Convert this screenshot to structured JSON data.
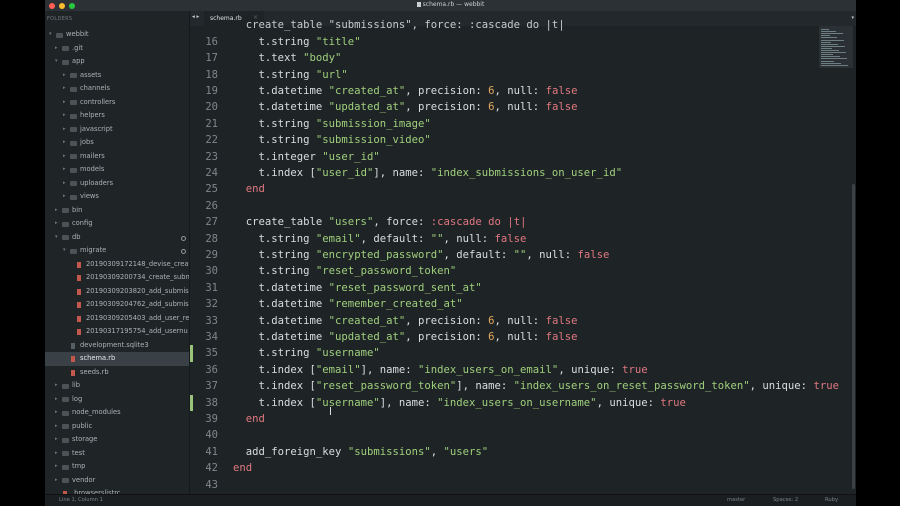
{
  "window": {
    "title": "schema.rb — webbit"
  },
  "colors": {
    "close": "#ff5f56",
    "minimize": "#ffbd2e",
    "maximize": "#27c93f"
  },
  "sidebar": {
    "header": "FOLDERS",
    "items": [
      {
        "label": "webbit",
        "type": "folder",
        "depth": 0,
        "open": true
      },
      {
        "label": ".git",
        "type": "folder",
        "depth": 1
      },
      {
        "label": "app",
        "type": "folder",
        "depth": 1,
        "open": true
      },
      {
        "label": "assets",
        "type": "folder",
        "depth": 2
      },
      {
        "label": "channels",
        "type": "folder",
        "depth": 2
      },
      {
        "label": "controllers",
        "type": "folder",
        "depth": 2
      },
      {
        "label": "helpers",
        "type": "folder",
        "depth": 2
      },
      {
        "label": "javascript",
        "type": "folder",
        "depth": 2
      },
      {
        "label": "jobs",
        "type": "folder",
        "depth": 2
      },
      {
        "label": "mailers",
        "type": "folder",
        "depth": 2
      },
      {
        "label": "models",
        "type": "folder",
        "depth": 2
      },
      {
        "label": "uploaders",
        "type": "folder",
        "depth": 2
      },
      {
        "label": "views",
        "type": "folder",
        "depth": 2
      },
      {
        "label": "bin",
        "type": "folder",
        "depth": 1
      },
      {
        "label": "config",
        "type": "folder",
        "depth": 1
      },
      {
        "label": "db",
        "type": "folder",
        "depth": 1,
        "open": true,
        "dot": true
      },
      {
        "label": "migrate",
        "type": "folder",
        "depth": 2,
        "open": true,
        "dot": true
      },
      {
        "label": "20190309172148_devise_create",
        "type": "file",
        "depth": 3
      },
      {
        "label": "20190309200734_create_subm",
        "type": "file",
        "depth": 3
      },
      {
        "label": "20190309203820_add_submiss",
        "type": "file",
        "depth": 3
      },
      {
        "label": "20190309204762_add_submiss",
        "type": "file",
        "depth": 3
      },
      {
        "label": "20190309205403_add_user_rel",
        "type": "file",
        "depth": 3
      },
      {
        "label": "20190317195754_add_usernu",
        "type": "file",
        "depth": 3
      },
      {
        "label": "development.sqlite3",
        "type": "db",
        "depth": 2
      },
      {
        "label": "schema.rb",
        "type": "file",
        "depth": 2,
        "selected": true
      },
      {
        "label": "seeds.rb",
        "type": "file",
        "depth": 2
      },
      {
        "label": "lib",
        "type": "folder",
        "depth": 1
      },
      {
        "label": "log",
        "type": "folder",
        "depth": 1
      },
      {
        "label": "node_modules",
        "type": "folder",
        "depth": 1
      },
      {
        "label": "public",
        "type": "folder",
        "depth": 1
      },
      {
        "label": "storage",
        "type": "folder",
        "depth": 1
      },
      {
        "label": "test",
        "type": "folder",
        "depth": 1
      },
      {
        "label": "tmp",
        "type": "folder",
        "depth": 1
      },
      {
        "label": "vendor",
        "type": "folder",
        "depth": 1
      },
      {
        "label": ".browserslistrc",
        "type": "file",
        "depth": 1
      }
    ]
  },
  "tabbar": {
    "nav": "◂ ▸",
    "tab_label": "schema.rb",
    "tab_close": "×",
    "menu": "▾"
  },
  "editor": {
    "lines": [
      {
        "n": "16",
        "tokens": [
          [
            "s",
            "    t.string "
          ],
          [
            "str",
            "\"title\""
          ]
        ]
      },
      {
        "n": "17",
        "tokens": [
          [
            "s",
            "    t.text "
          ],
          [
            "str",
            "\"body\""
          ]
        ]
      },
      {
        "n": "18",
        "tokens": [
          [
            "s",
            "    t.string "
          ],
          [
            "str",
            "\"url\""
          ]
        ]
      },
      {
        "n": "19",
        "tokens": [
          [
            "s",
            "    t.datetime "
          ],
          [
            "str",
            "\"created_at\""
          ],
          [
            "s",
            ", precision: "
          ],
          [
            "num",
            "6"
          ],
          [
            "s",
            ", null: "
          ],
          [
            "kw",
            "false"
          ]
        ]
      },
      {
        "n": "20",
        "tokens": [
          [
            "s",
            "    t.datetime "
          ],
          [
            "str",
            "\"updated_at\""
          ],
          [
            "s",
            ", precision: "
          ],
          [
            "num",
            "6"
          ],
          [
            "s",
            ", null: "
          ],
          [
            "kw",
            "false"
          ]
        ]
      },
      {
        "n": "21",
        "tokens": [
          [
            "s",
            "    t.string "
          ],
          [
            "str",
            "\"submission_image\""
          ]
        ]
      },
      {
        "n": "22",
        "tokens": [
          [
            "s",
            "    t.string "
          ],
          [
            "str",
            "\"submission_video\""
          ]
        ]
      },
      {
        "n": "23",
        "tokens": [
          [
            "s",
            "    t.integer "
          ],
          [
            "str",
            "\"user_id\""
          ]
        ]
      },
      {
        "n": "24",
        "tokens": [
          [
            "s",
            "    t.index ["
          ],
          [
            "str",
            "\"user_id\""
          ],
          [
            "s",
            "], name: "
          ],
          [
            "str",
            "\"index_submissions_on_user_id\""
          ]
        ]
      },
      {
        "n": "25",
        "tokens": [
          [
            "kw",
            "  end"
          ]
        ]
      },
      {
        "n": "26",
        "tokens": []
      },
      {
        "n": "27",
        "tokens": [
          [
            "s",
            "  create_table "
          ],
          [
            "str",
            "\"users\""
          ],
          [
            "s",
            ", force: "
          ],
          [
            "sym",
            ":cascade"
          ],
          [
            "s",
            " "
          ],
          [
            "kw",
            "do"
          ],
          [
            "s",
            " "
          ],
          [
            "pipe",
            "|"
          ],
          [
            "var",
            "t"
          ],
          [
            "pipe",
            "|"
          ]
        ]
      },
      {
        "n": "28",
        "tokens": [
          [
            "s",
            "    t.string "
          ],
          [
            "str",
            "\"email\""
          ],
          [
            "s",
            ", default: "
          ],
          [
            "str",
            "\"\""
          ],
          [
            "s",
            ", null: "
          ],
          [
            "kw",
            "false"
          ]
        ]
      },
      {
        "n": "29",
        "tokens": [
          [
            "s",
            "    t.string "
          ],
          [
            "str",
            "\"encrypted_password\""
          ],
          [
            "s",
            ", default: "
          ],
          [
            "str",
            "\"\""
          ],
          [
            "s",
            ", null: "
          ],
          [
            "kw",
            "false"
          ]
        ]
      },
      {
        "n": "30",
        "tokens": [
          [
            "s",
            "    t.string "
          ],
          [
            "str",
            "\"reset_password_token\""
          ]
        ]
      },
      {
        "n": "31",
        "tokens": [
          [
            "s",
            "    t.datetime "
          ],
          [
            "str",
            "\"reset_password_sent_at\""
          ]
        ]
      },
      {
        "n": "32",
        "tokens": [
          [
            "s",
            "    t.datetime "
          ],
          [
            "str",
            "\"remember_created_at\""
          ]
        ]
      },
      {
        "n": "33",
        "tokens": [
          [
            "s",
            "    t.datetime "
          ],
          [
            "str",
            "\"created_at\""
          ],
          [
            "s",
            ", precision: "
          ],
          [
            "num",
            "6"
          ],
          [
            "s",
            ", null: "
          ],
          [
            "kw",
            "false"
          ]
        ]
      },
      {
        "n": "34",
        "tokens": [
          [
            "s",
            "    t.datetime "
          ],
          [
            "str",
            "\"updated_at\""
          ],
          [
            "s",
            ", precision: "
          ],
          [
            "num",
            "6"
          ],
          [
            "s",
            ", null: "
          ],
          [
            "kw",
            "false"
          ]
        ]
      },
      {
        "n": "35",
        "tokens": [
          [
            "s",
            "    t.string "
          ],
          [
            "str",
            "\"username\""
          ]
        ],
        "modified": true
      },
      {
        "n": "36",
        "tokens": [
          [
            "s",
            "    t.index ["
          ],
          [
            "str",
            "\"email\""
          ],
          [
            "s",
            "], name: "
          ],
          [
            "str",
            "\"index_users_on_email\""
          ],
          [
            "s",
            ", unique: "
          ],
          [
            "kw",
            "true"
          ]
        ]
      },
      {
        "n": "37",
        "tokens": [
          [
            "s",
            "    t.index ["
          ],
          [
            "str",
            "\"reset_password_token\""
          ],
          [
            "s",
            "], name: "
          ],
          [
            "str",
            "\"index_users_on_reset_password_token\""
          ],
          [
            "s",
            ", unique: "
          ],
          [
            "kw",
            "true"
          ]
        ]
      },
      {
        "n": "38",
        "tokens": [
          [
            "s",
            "    t.index ["
          ],
          [
            "str",
            "\"username\""
          ],
          [
            "s",
            "], name: "
          ],
          [
            "str",
            "\"index_users_on_username\""
          ],
          [
            "s",
            ", unique: "
          ],
          [
            "kw",
            "true"
          ]
        ],
        "modified": true
      },
      {
        "n": "39",
        "tokens": [
          [
            "kw",
            "  end"
          ]
        ]
      },
      {
        "n": "40",
        "tokens": []
      },
      {
        "n": "41",
        "tokens": [
          [
            "s",
            "  add_foreign_key "
          ],
          [
            "str",
            "\"submissions\""
          ],
          [
            "s",
            ", "
          ],
          [
            "str",
            "\"users\""
          ]
        ]
      },
      {
        "n": "42",
        "tokens": [
          [
            "kw",
            "end"
          ]
        ]
      },
      {
        "n": "43",
        "tokens": []
      }
    ],
    "partial_top_line": "create_table \"submissions\", force: :cascade do |t|"
  },
  "statusbar": {
    "position": "Line 1, Column 1",
    "branch": "master",
    "spaces": "Spaces: 2",
    "syntax": "Ruby"
  }
}
